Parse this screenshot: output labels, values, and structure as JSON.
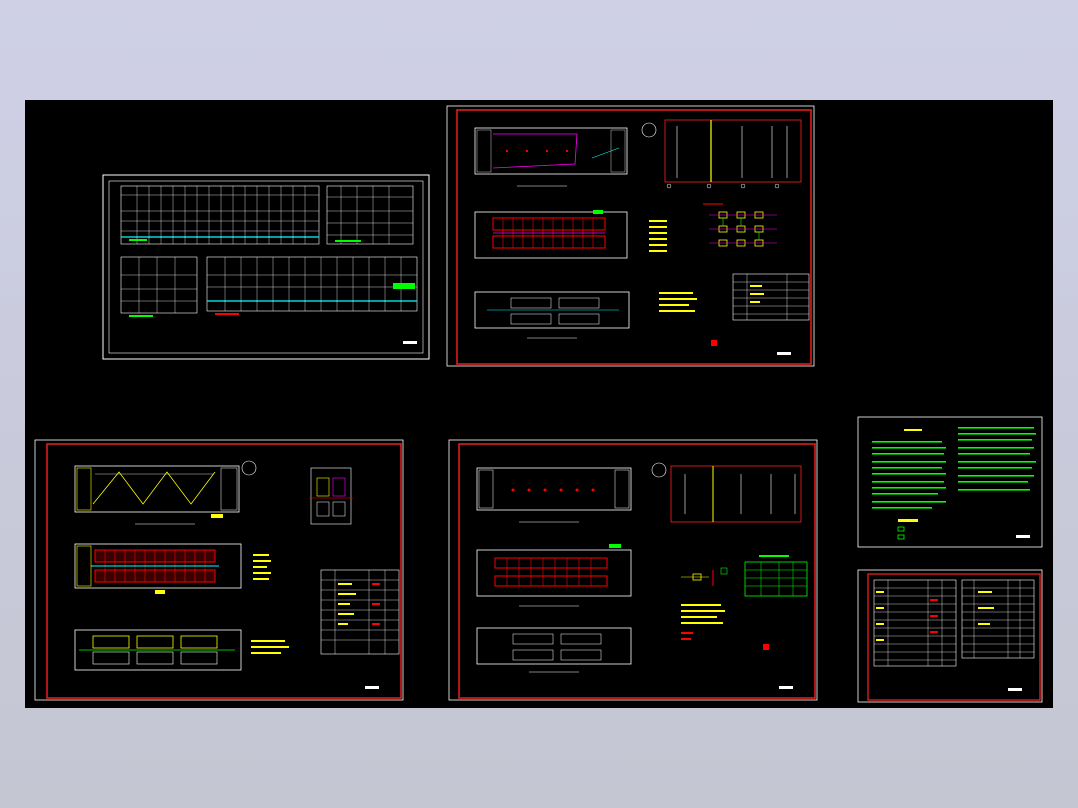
{
  "viewer": {
    "background_colors": [
      "#cfd0e6",
      "#c4c6d2"
    ],
    "canvas_color": "#000000"
  },
  "drawing_colors": {
    "frame_red": "#ff2020",
    "white": "#ffffff",
    "green": "#00ff00",
    "yellow": "#ffff00",
    "cyan": "#00ffff",
    "magenta": "#ff00ff",
    "red": "#ff0000"
  },
  "sheets": [
    {
      "id": "sheet-schedule-tables",
      "frame": "white"
    },
    {
      "id": "sheet-electrical-plans-top",
      "frame": "red"
    },
    {
      "id": "sheet-plans-left",
      "frame": "red"
    },
    {
      "id": "sheet-plans-center",
      "frame": "red"
    },
    {
      "id": "sheet-general-notes",
      "frame": "white"
    },
    {
      "id": "sheet-material-list",
      "frame": "red"
    }
  ]
}
